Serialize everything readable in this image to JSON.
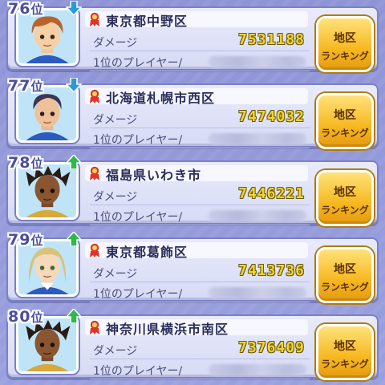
{
  "labels": {
    "damage": "ダメージ",
    "top_player": "1位のプレイヤー/",
    "button_line1": "地区",
    "button_line2": "ランキング"
  },
  "rows": [
    {
      "rank": "76",
      "rank_suffix": "位",
      "trend": "down",
      "region": "東京都中野区",
      "damage": "7531188",
      "avatar": "brown-hair-boy"
    },
    {
      "rank": "77",
      "rank_suffix": "位",
      "trend": "down",
      "region": "北海道札幌市西区",
      "damage": "7474032",
      "avatar": "dark-hair-boy"
    },
    {
      "rank": "78",
      "rank_suffix": "位",
      "trend": "up",
      "region": "福島県いわき市",
      "damage": "7446221",
      "avatar": "dreadlocks-boy"
    },
    {
      "rank": "79",
      "rank_suffix": "位",
      "trend": "up",
      "region": "東京都葛飾区",
      "damage": "7413736",
      "avatar": "blonde-boy"
    },
    {
      "rank": "80",
      "rank_suffix": "位",
      "trend": "up",
      "region": "神奈川県横浜市南区",
      "damage": "7376409",
      "avatar": "dreadlocks-boy"
    }
  ],
  "colors": {
    "background": "#959ad9",
    "card": "#e1e4f8",
    "damage_text": "#f2d531",
    "button": "#f6b820",
    "arrow_up": "#2fb84a",
    "arrow_down": "#2b9bd6"
  }
}
